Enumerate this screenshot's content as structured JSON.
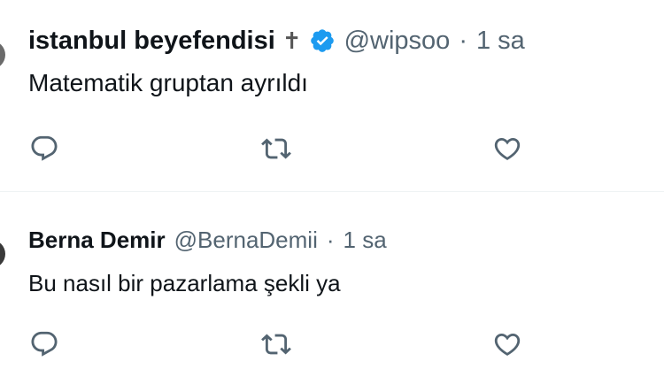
{
  "tweets": [
    {
      "name": "istanbul beyefendisi",
      "emoji": "✝",
      "verified": true,
      "handle": "@wipsoo",
      "separator": "·",
      "time": "1 sa",
      "text": "Matematik gruptan ayrıldı"
    },
    {
      "name": "Berna Demir",
      "verified": false,
      "handle": "@BernaDemii",
      "separator": "·",
      "time": "1 sa",
      "text": "Bu nasıl bir pazarlama şekli ya"
    }
  ],
  "icons": {
    "reply": "reply-icon",
    "retweet": "retweet-icon",
    "like": "heart-icon",
    "verified": "verified-badge-icon"
  },
  "colors": {
    "text": "#0f1419",
    "secondary": "#536471",
    "verified": "#1d9bf0",
    "divider": "#eff3f4"
  }
}
